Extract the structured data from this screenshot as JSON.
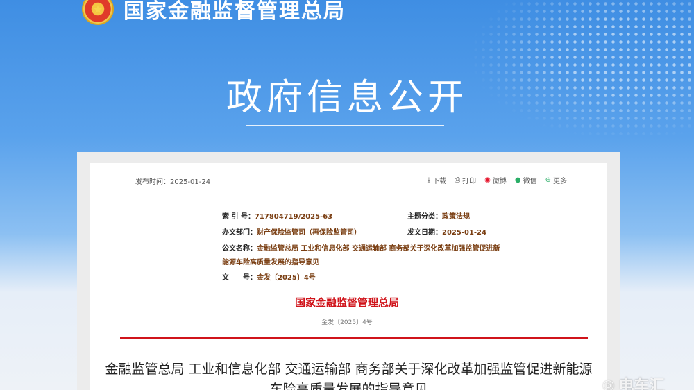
{
  "header": {
    "org_name": "国家金融监督管理总局"
  },
  "banner": {
    "title": "政府信息公开"
  },
  "toolbar": {
    "publish_date": "发布时间：2025-01-24",
    "download": "下载",
    "print": "打印",
    "weibo": "微博",
    "wechat": "微信",
    "more": "更多"
  },
  "meta": {
    "index_label": "索 引 号：",
    "index_value": "717804719/2025-63",
    "topic_label": "主题分类：",
    "topic_value": "政策法规",
    "dept_label": "办文部门：",
    "dept_value": "财产保险监管司（再保险监管司）",
    "date_label": "发文日期：",
    "date_value": "2025-01-24",
    "docname_label": "公文名称：",
    "docname_value_line1": "金融监管总局 工业和信息化部 交通运输部 商务部关于深化改革加强监管促进新",
    "docname_value_line2": "能源车险高质量发展的指导意见",
    "docno_label": "文　　号：",
    "docno_value": "金发〔2025〕4号"
  },
  "document": {
    "issuer": "国家金融监督管理总局",
    "number": "金发〔2025〕4号",
    "title_line1": "金融监管总局 工业和信息化部 交通运输部 商务部关于深化改革加强监管促进新能源",
    "title_line2": "车险高质量发展的指导意见"
  },
  "watermark": {
    "text": "电车汇"
  },
  "icons": {
    "emblem": "national-emblem-icon",
    "download": "download-icon",
    "print": "printer-icon",
    "weibo": "weibo-icon",
    "wechat": "wechat-icon",
    "more": "plus-circle-icon"
  }
}
